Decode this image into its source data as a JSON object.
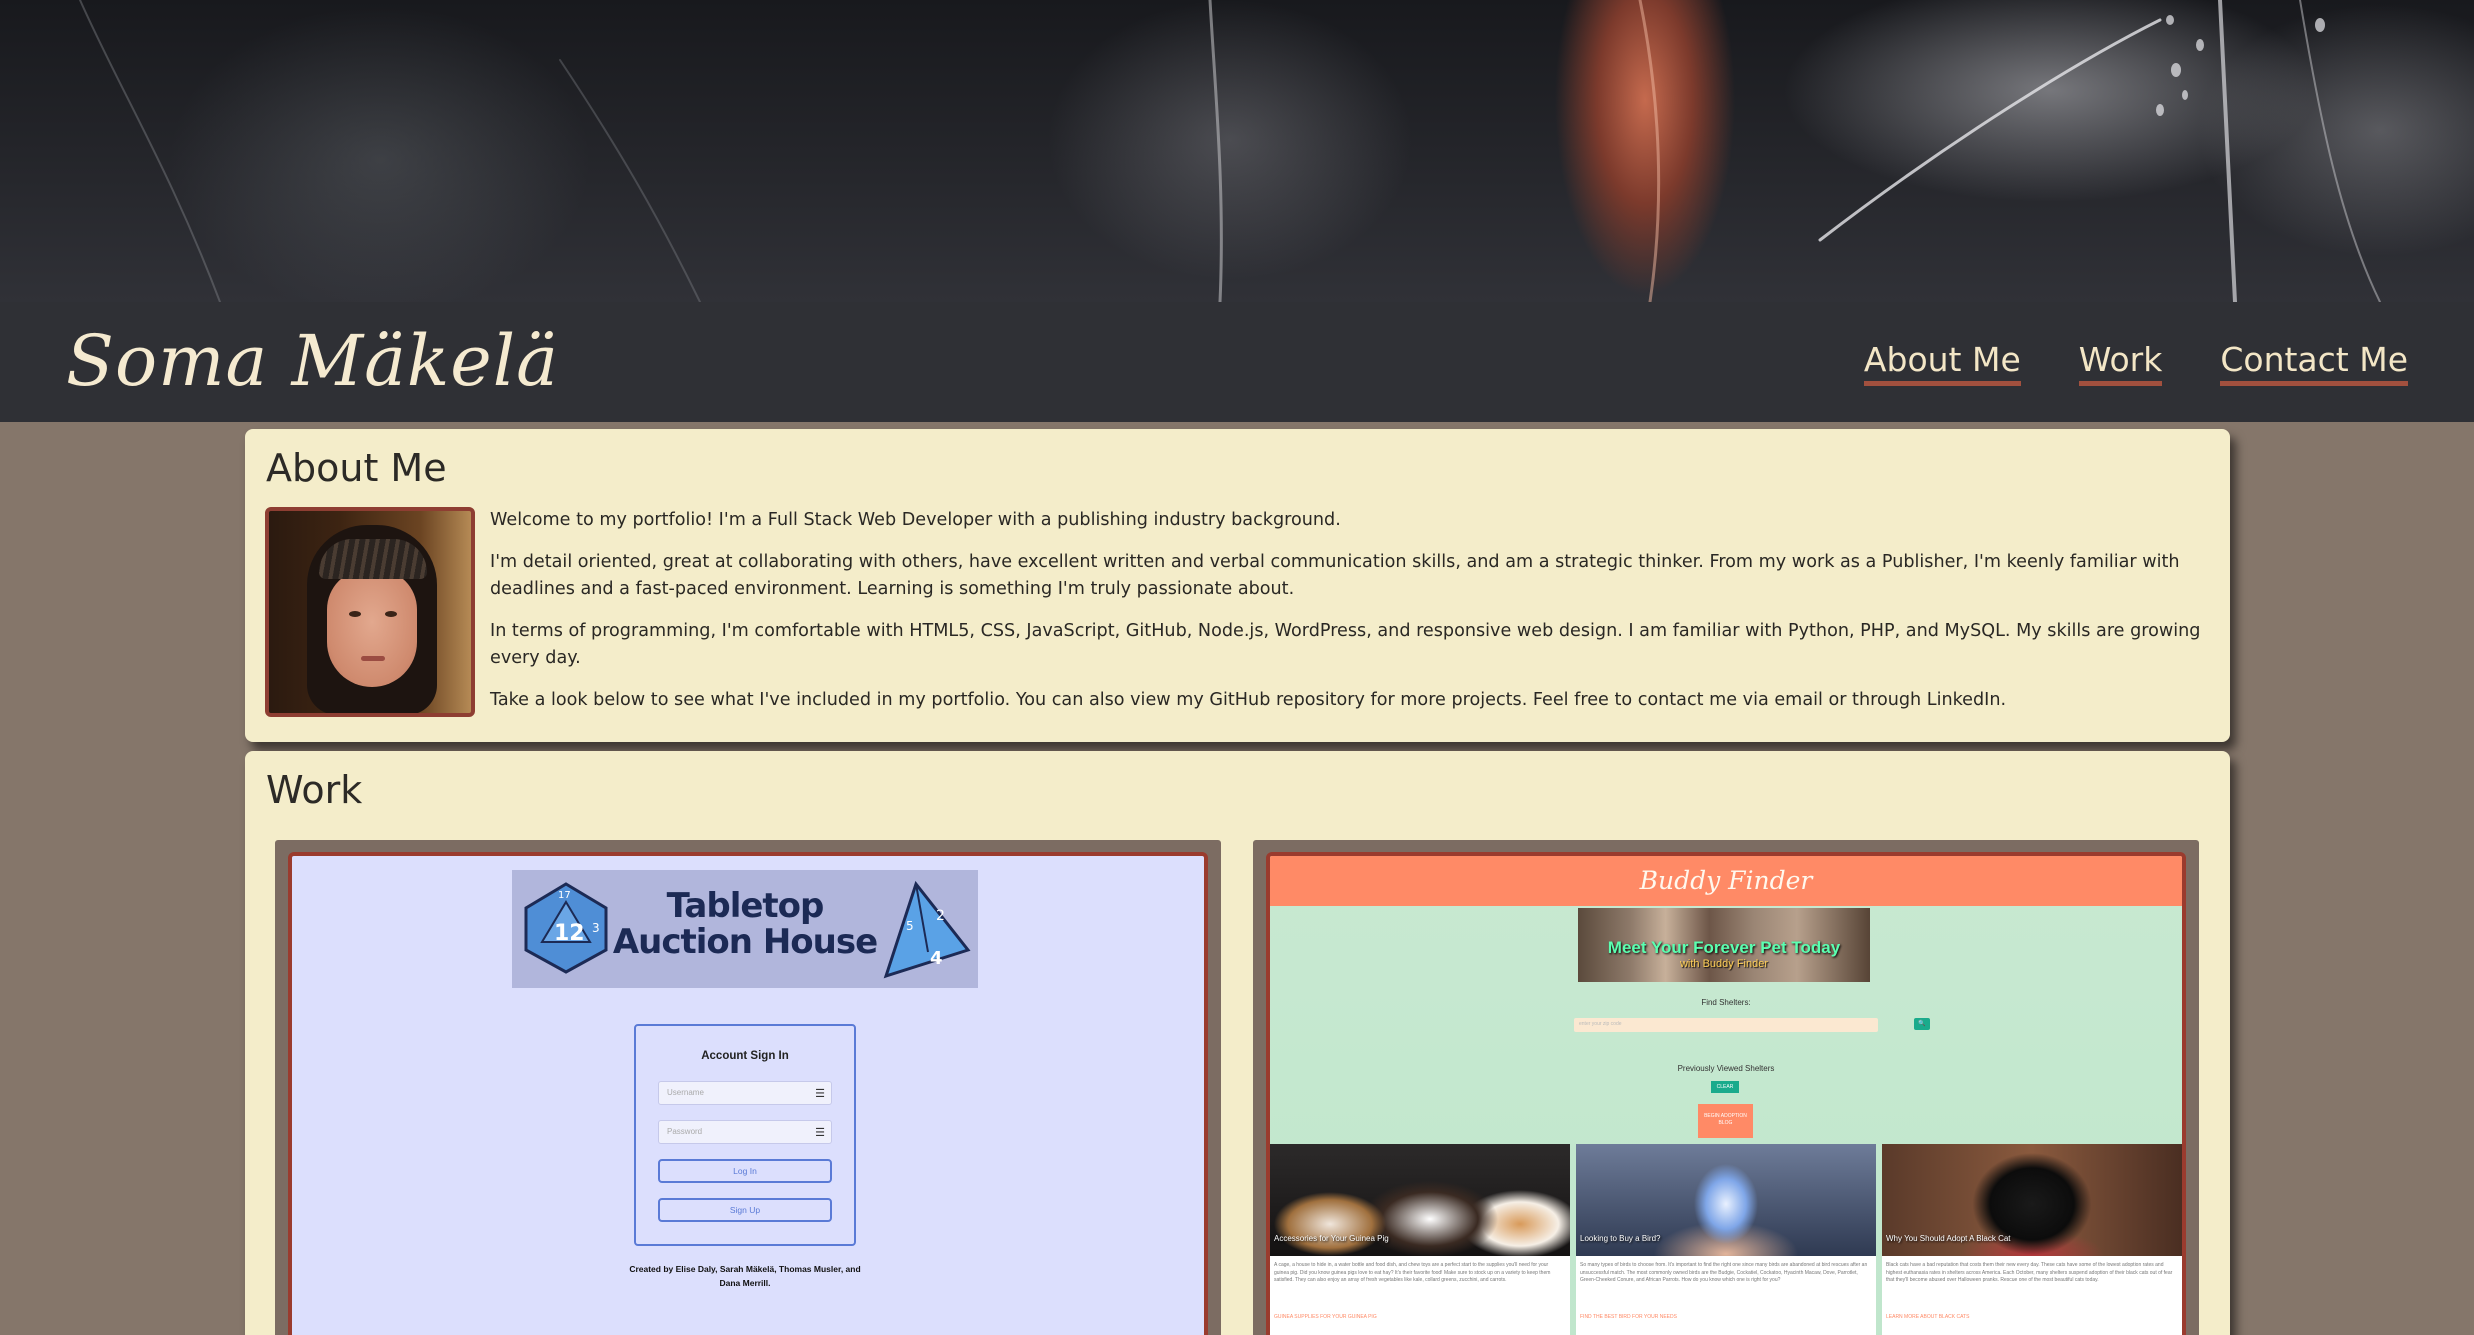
{
  "site": {
    "name": "Soma Mäkelä",
    "nav": [
      "About Me",
      "Work",
      "Contact Me"
    ]
  },
  "about": {
    "heading": "About Me",
    "paragraphs": [
      "Welcome to my portfolio! I'm a Full Stack Web Developer with a publishing industry background.",
      "I'm detail oriented, great at collaborating with others, have excellent written and verbal communication skills, and am a strategic thinker. From my work as a Publisher, I'm keenly familiar with deadlines and a fast-paced environment. Learning is something I'm truly passionate about.",
      "In terms of programming, I'm comfortable with HTML5, CSS, JavaScript, GitHub, Node.js, WordPress, and responsive web design. I am familiar with Python, PHP, and MySQL. My skills are growing every day.",
      "Take a look below to see what I've included in my portfolio. You can also view my GitHub repository for more projects. Feel free to contact me via email or through LinkedIn."
    ]
  },
  "work": {
    "heading": "Work",
    "projects": [
      {
        "logo_title": "Tabletop Auction House",
        "dice_left": [
          "12",
          "3",
          "17"
        ],
        "dice_right": [
          "4",
          "2",
          "5"
        ],
        "signin_title": "Account Sign In",
        "username_placeholder": "Username",
        "password_placeholder": "Password",
        "login_label": "Log In",
        "signup_label": "Sign Up",
        "credit": "Created by Elise Daly, Sarah Mäkelä, Thomas Musler, and Dana Merrill."
      },
      {
        "title": "Buddy Finder",
        "banner_title": "Meet Your Forever Pet Today",
        "banner_sub": "with Buddy Finder",
        "find_label": "Find Shelters:",
        "search_placeholder": "enter your zip code",
        "search_button": "🔍",
        "previous_label": "Previously Viewed Shelters",
        "clear_label": "CLEAR",
        "blog_label": "BEGIN ADOPTION BLOG",
        "posts": [
          {
            "caption": "Accessories for Your Guinea Pig",
            "text": "A cage, a house to hide in, a water bottle and food dish, and chew toys are a perfect start to the supplies you'll need for your guinea pig. Did you know guinea pigs love to eat hay? It's their favorite food! Make sure to stock up on a variety to keep them satisfied. They can also enjoy an array of fresh vegetables like kale, collard greens, zucchini, and carrots.",
            "link": "GUINEA SUPPLIES FOR YOUR GUINEA PIG"
          },
          {
            "caption": "Looking to Buy a Bird?",
            "text": "So many types of birds to choose from. It's important to find the right one since many birds are abandoned at bird rescues after an unsuccessful match. The most commonly owned birds are the Budgie, Cockatiel, Cockatoo, Hyacinth Macaw, Dove, Parrotlet, Green-Cheeked Conure, and African Parrots. How do you know which one is right for you?",
            "link": "FIND THE BEST BIRD FOR YOUR NEEDS"
          },
          {
            "caption": "Why You Should Adopt A Black Cat",
            "text": "Black cats have a bad reputation that costs them their new every day. These cats have some of the lowest adoption rates and highest euthanasia rates in shelters across America. Each October, many shelters suspend adoption of their black cats out of fear that they'll become abused over Halloween pranks. Rescue one of the most beautiful cats today.",
            "link": "LEARN MORE ABOUT BLACK CATS"
          }
        ]
      }
    ]
  },
  "colors": {
    "page_bg": "#85766a",
    "header_bar": "#2f3035",
    "card_bg": "#f4edca",
    "accent_underline": "#a2503e",
    "nav_text": "#f3e6c6",
    "buddy_orange": "#ff8a66",
    "buddy_mint": "#c8e9d1",
    "tabletop_lavender": "#dcdffd"
  },
  "icons": [
    "feather-banner-image",
    "profile-photo",
    "d20-dice-icon",
    "d4-dice-icon",
    "menu-lines-icon",
    "search-icon"
  ]
}
